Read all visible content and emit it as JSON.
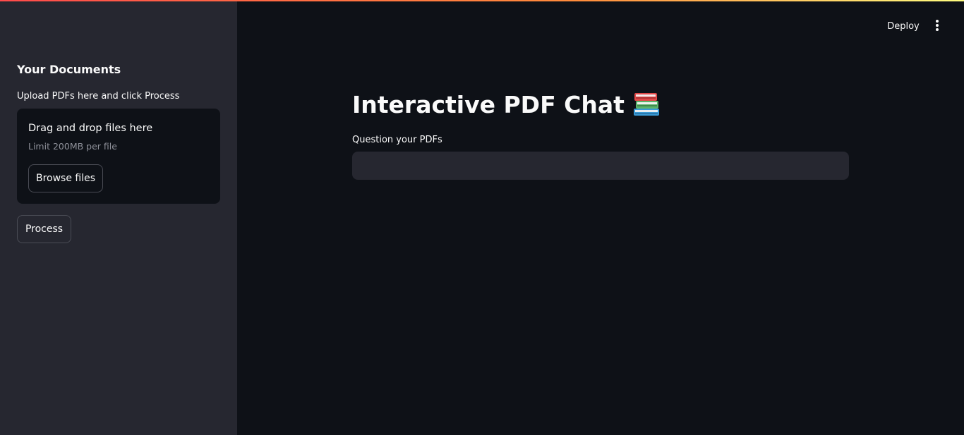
{
  "sidebar": {
    "header": "Your Documents",
    "uploader": {
      "label": "Upload PDFs here and click Process",
      "dropzone_title": "Drag and drop files here",
      "limit_text": "Limit 200MB per file",
      "browse_label": "Browse files"
    },
    "process_label": "Process"
  },
  "header": {
    "deploy_label": "Deploy",
    "menu_icon": "vertical-ellipsis-icon"
  },
  "main": {
    "title": "Interactive PDF Chat",
    "title_icon": "books-icon",
    "question_label": "Question your PDFs",
    "question_value": ""
  },
  "colors": {
    "background": "#0e1117",
    "sidebar": "#262730",
    "input": "#262730",
    "text": "#fafafa",
    "muted": "#8e9099",
    "accent_gradient_start": "#ff4b4b",
    "accent_gradient_end": "#fffd80"
  }
}
